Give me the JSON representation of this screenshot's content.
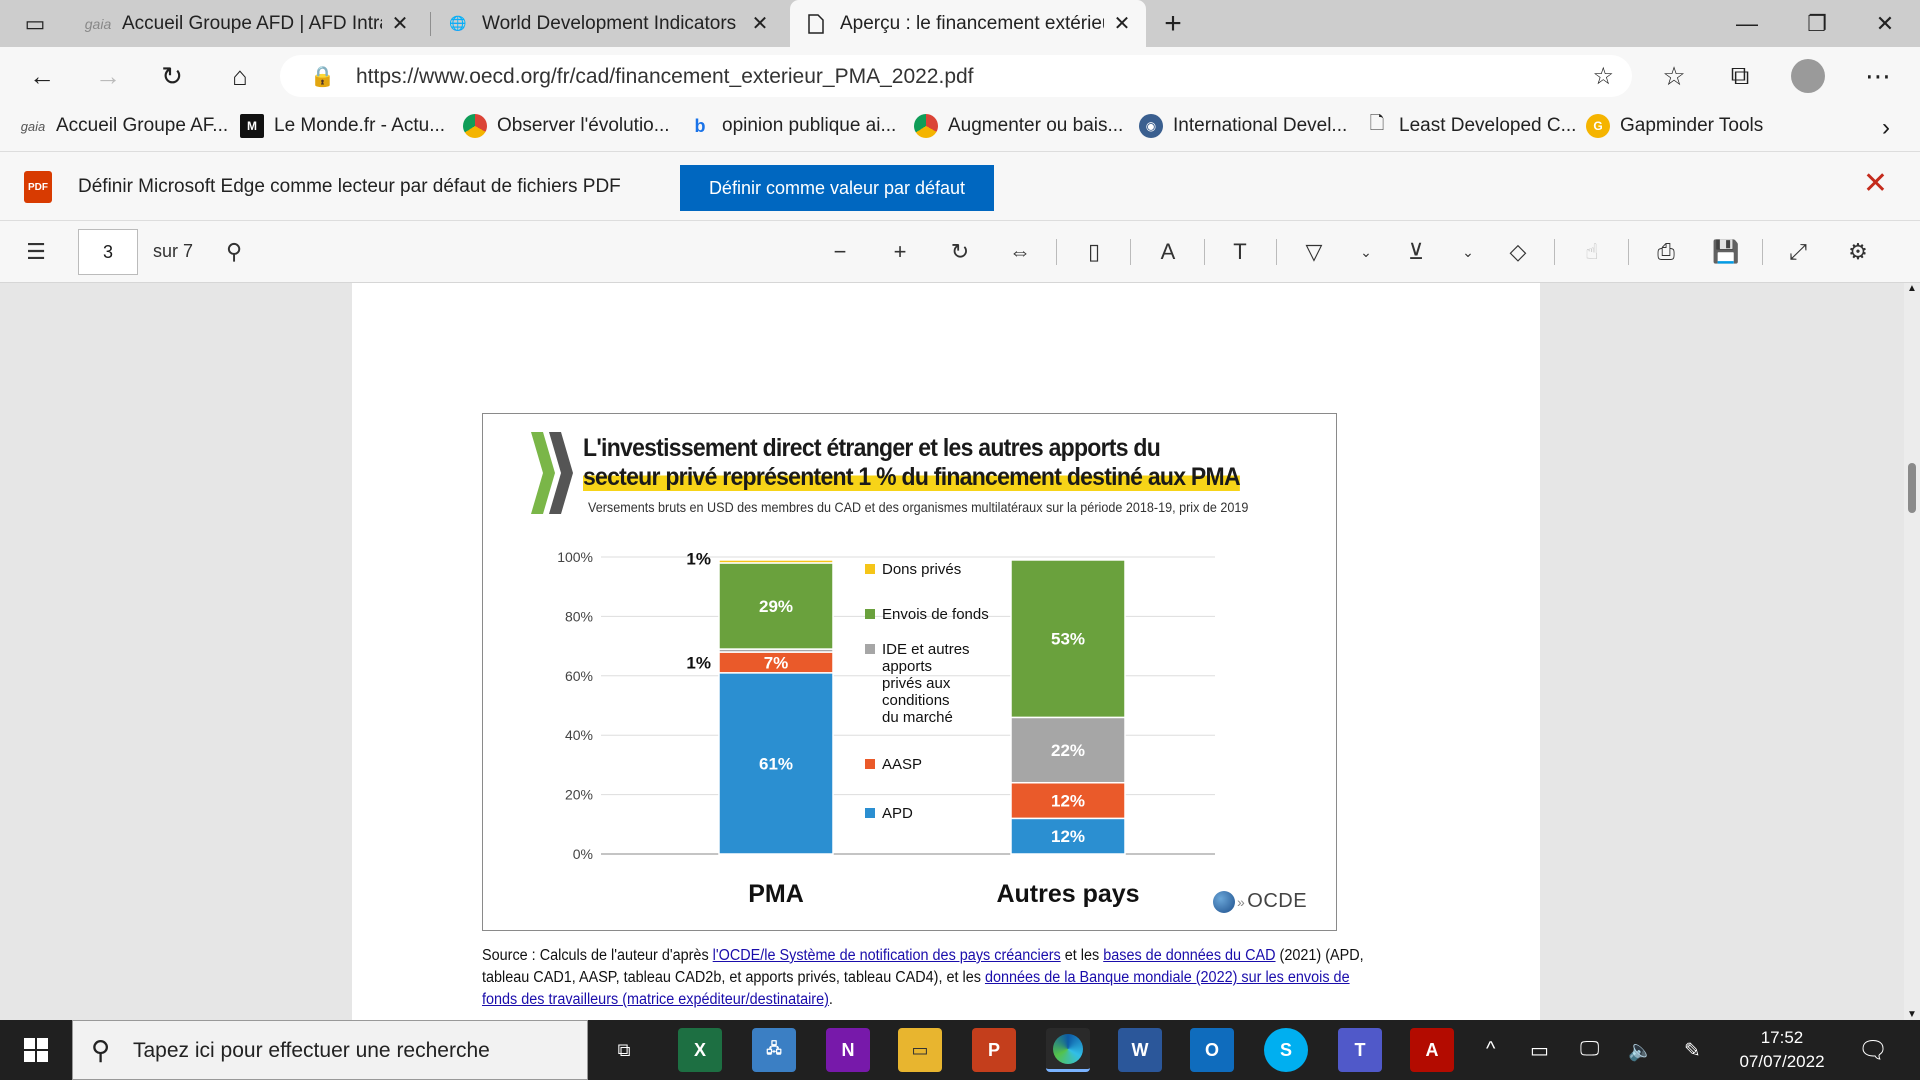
{
  "browser": {
    "tabs": [
      {
        "title": "Accueil Groupe AFD | AFD Intran",
        "favicon": "gaia"
      },
      {
        "title": "World Development Indicators | I",
        "favicon": "globe-icon"
      },
      {
        "title": "Aperçu : le financement extérieu",
        "favicon": "document-icon"
      }
    ],
    "url": "https://www.oecd.org/fr/cad/financement_exterieur_PMA_2022.pdf",
    "bookmarks": [
      {
        "label": "Accueil Groupe AF...",
        "icon": "gaia"
      },
      {
        "label": "Le Monde.fr - Actu...",
        "icon": "M"
      },
      {
        "label": "Observer l'évolutio...",
        "icon": "chrome"
      },
      {
        "label": "opinion publique ai...",
        "icon": "b"
      },
      {
        "label": "Augmenter ou bais...",
        "icon": "chrome"
      },
      {
        "label": "International Devel...",
        "icon": "idb"
      },
      {
        "label": "Least Developed C...",
        "icon": "doc"
      },
      {
        "label": "Gapminder Tools",
        "icon": "G"
      }
    ],
    "infobar": {
      "message": "Définir Microsoft Edge comme lecteur par défaut de fichiers PDF",
      "button": "Définir comme valeur par défaut",
      "pdf_icon_label": "PDF"
    },
    "pdf_toolbar": {
      "page": "3",
      "of": "sur 7"
    }
  },
  "document": {
    "figure": {
      "title_line1": "L'investissement direct étranger et les autres apports du",
      "title_line2": "secteur privé représentent 1 % du financement destiné aux PMA",
      "subtitle": "Versements bruts en USD des membres du CAD et des organismes multilatéraux sur la période 2018-19, prix de 2019",
      "logo_text": "OCDE"
    },
    "source": {
      "t1": "Source : Calculs de l'auteur d'après ",
      "l1": "l'OCDE/le Système de notification des pays créanciers",
      "t2": " et les ",
      "l2": "bases de données du CAD",
      "t3": " (2021) (APD, tableau CAD1, AASP, tableau CAD2b, et apports privés, tableau CAD4), et les ",
      "l3": "données de la Banque mondiale (2022) sur les envois de fonds des travailleurs (matrice expéditeur/destinataire)",
      "t4": "."
    }
  },
  "chart_data": {
    "type": "bar",
    "stacked": true,
    "categories": [
      "PMA",
      "Autres pays"
    ],
    "series": [
      {
        "name": "APD",
        "color": "#2b8fd1",
        "values": [
          61,
          12
        ],
        "labels": [
          "61%",
          "12%"
        ]
      },
      {
        "name": "AASP",
        "color": "#ea5a2a",
        "values": [
          7,
          12
        ],
        "labels": [
          "7%",
          "12%"
        ]
      },
      {
        "name": "IDE et autres apports privés aux conditions du marché",
        "color": "#a6a6a6",
        "values": [
          1,
          22
        ],
        "labels": [
          "1%",
          "22%"
        ]
      },
      {
        "name": "Envois de fonds",
        "color": "#6aa13d",
        "values": [
          29,
          53
        ],
        "labels": [
          "29%",
          "53%"
        ]
      },
      {
        "name": "Dons privés",
        "color": "#f5c518",
        "values": [
          1,
          0
        ],
        "labels": [
          "1%",
          ""
        ]
      }
    ],
    "legend_lines": {
      "Dons privés": [
        "Dons privés"
      ],
      "Envois de fonds": [
        "Envois de fonds"
      ],
      "IDE et autres apports privés aux conditions du marché": [
        "IDE et autres",
        "apports",
        "privés aux",
        "conditions",
        "du marché"
      ],
      "AASP": [
        "AASP"
      ],
      "APD": [
        "APD"
      ]
    },
    "yticks": [
      "0%",
      "20%",
      "40%",
      "60%",
      "80%",
      "100%"
    ],
    "ylim": [
      0,
      100
    ],
    "grid": true,
    "legend_position": "between-bars"
  },
  "taskbar": {
    "search_placeholder": "Tapez ici pour effectuer une recherche",
    "time": "17:52",
    "date": "07/07/2022"
  }
}
